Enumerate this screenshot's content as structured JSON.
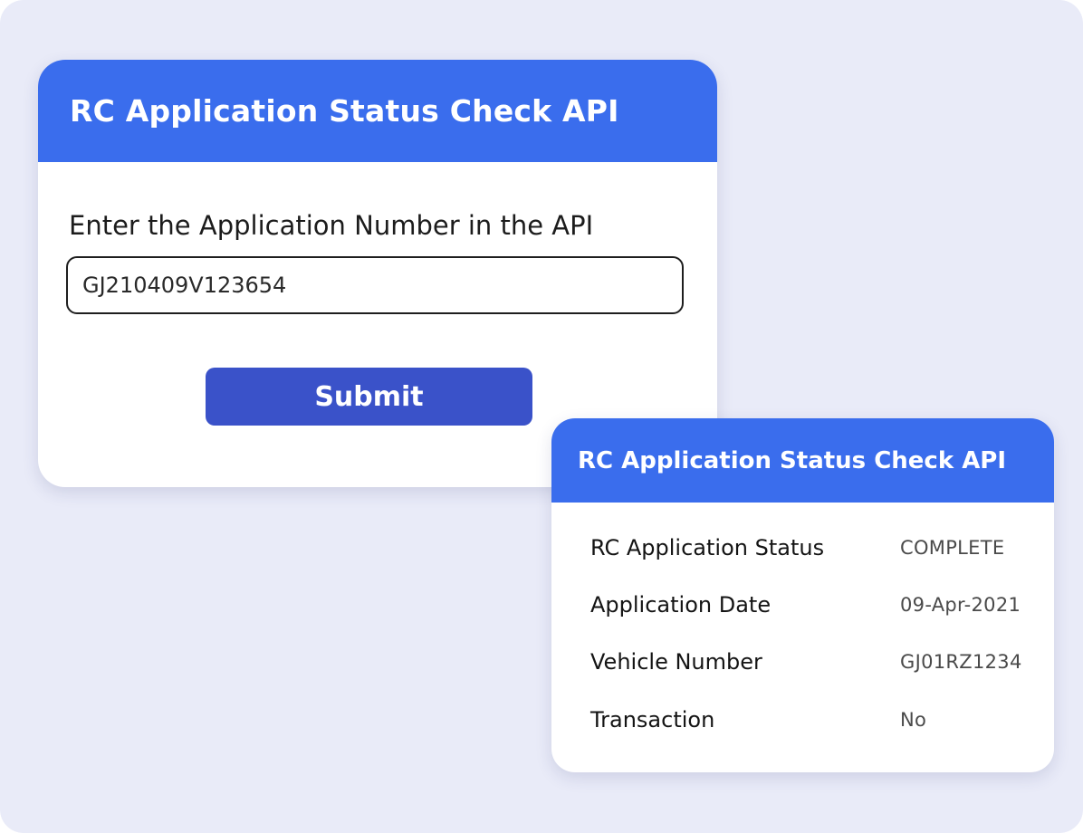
{
  "request_card": {
    "title": "RC Application Status Check API",
    "field_label": "Enter the Application Number in the API",
    "application_number": "GJ210409V123654",
    "submit_label": "Submit"
  },
  "result_card": {
    "title": "RC Application Status Check API",
    "rows": [
      {
        "label": "RC Application Status",
        "value": "COMPLETE"
      },
      {
        "label": "Application Date",
        "value": "09-Apr-2021"
      },
      {
        "label": "Vehicle Number",
        "value": "GJ01RZ1234"
      },
      {
        "label": "Transaction",
        "value": "No"
      }
    ]
  },
  "colors": {
    "background": "#e9ebf8",
    "header_blue": "#3a6ded",
    "button_blue": "#3a52c9",
    "card": "#ffffff"
  }
}
